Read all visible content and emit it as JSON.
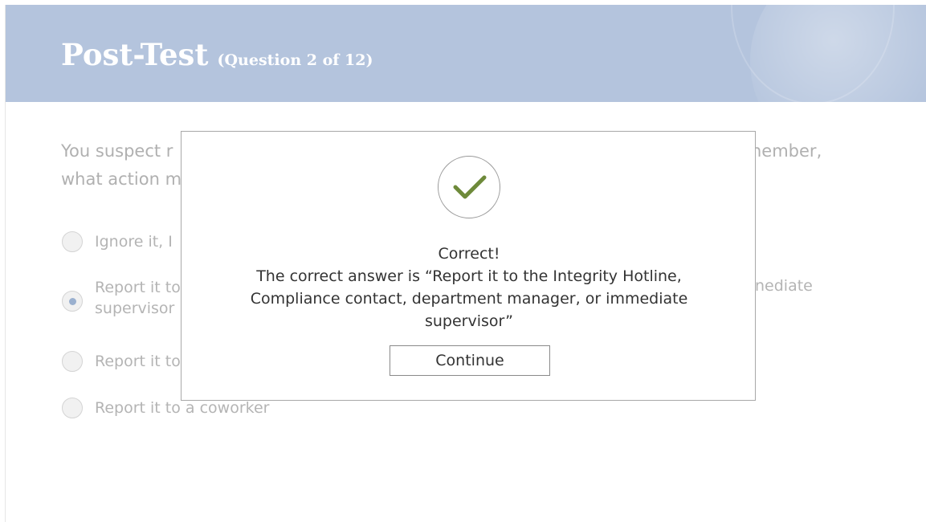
{
  "header": {
    "title": "Post-Test",
    "subtitle": "(Question 2 of 12)"
  },
  "question": {
    "line1_left": "You suspect r",
    "line1_right": "nember,",
    "line2_left": "what action m"
  },
  "choices": [
    {
      "text": "Ignore it, I",
      "selected": false
    },
    {
      "text_line1": "Report it to",
      "text_line2": "supervisor",
      "right_fragment": "nediate",
      "selected": true
    },
    {
      "text": "Report it to",
      "selected": false
    },
    {
      "text": "Report it to a coworker",
      "selected": false
    }
  ],
  "modal": {
    "icon": "checkmark-icon",
    "heading": "Correct!",
    "message_line1": "The correct answer is “Report it to the Integrity Hotline,",
    "message_line2": "Compliance contact, department manager, or immediate",
    "message_line3": "supervisor”",
    "continue_label": "Continue"
  },
  "colors": {
    "header_bg": "#b4c4dd",
    "check_green": "#6e8a3a"
  }
}
